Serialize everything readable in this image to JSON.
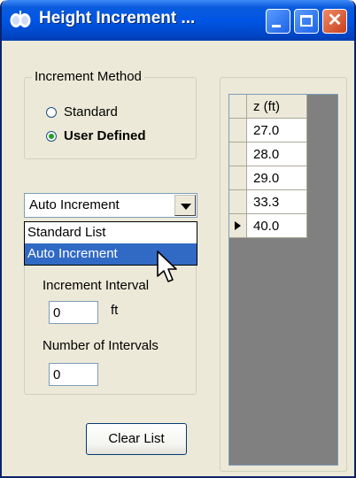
{
  "window": {
    "title": "Height Increment ...",
    "accent_color": "#0054E3",
    "icons": {
      "app": "lung-icon",
      "minimize": "minimize-icon",
      "maximize": "maximize-icon",
      "close": "close-icon"
    }
  },
  "increment_method": {
    "label": "Increment Method",
    "options": [
      {
        "label": "Standard",
        "checked": false
      },
      {
        "label": "User Defined",
        "checked": true
      }
    ]
  },
  "mode_combo": {
    "selected": "Auto Increment",
    "options": [
      "Standard List",
      "Auto Increment"
    ],
    "highlighted": "Auto Increment"
  },
  "interval": {
    "label": "Increment Interval",
    "value": "0",
    "unit": "ft"
  },
  "count": {
    "label": "Number of Intervals",
    "value": "0"
  },
  "clear_button": {
    "label": "Clear List"
  },
  "grid": {
    "header": "z (ft)",
    "rows": [
      "27.0",
      "28.0",
      "29.0",
      "33.3",
      "40.0"
    ],
    "current_row": 5
  },
  "close_glyph": "✕"
}
